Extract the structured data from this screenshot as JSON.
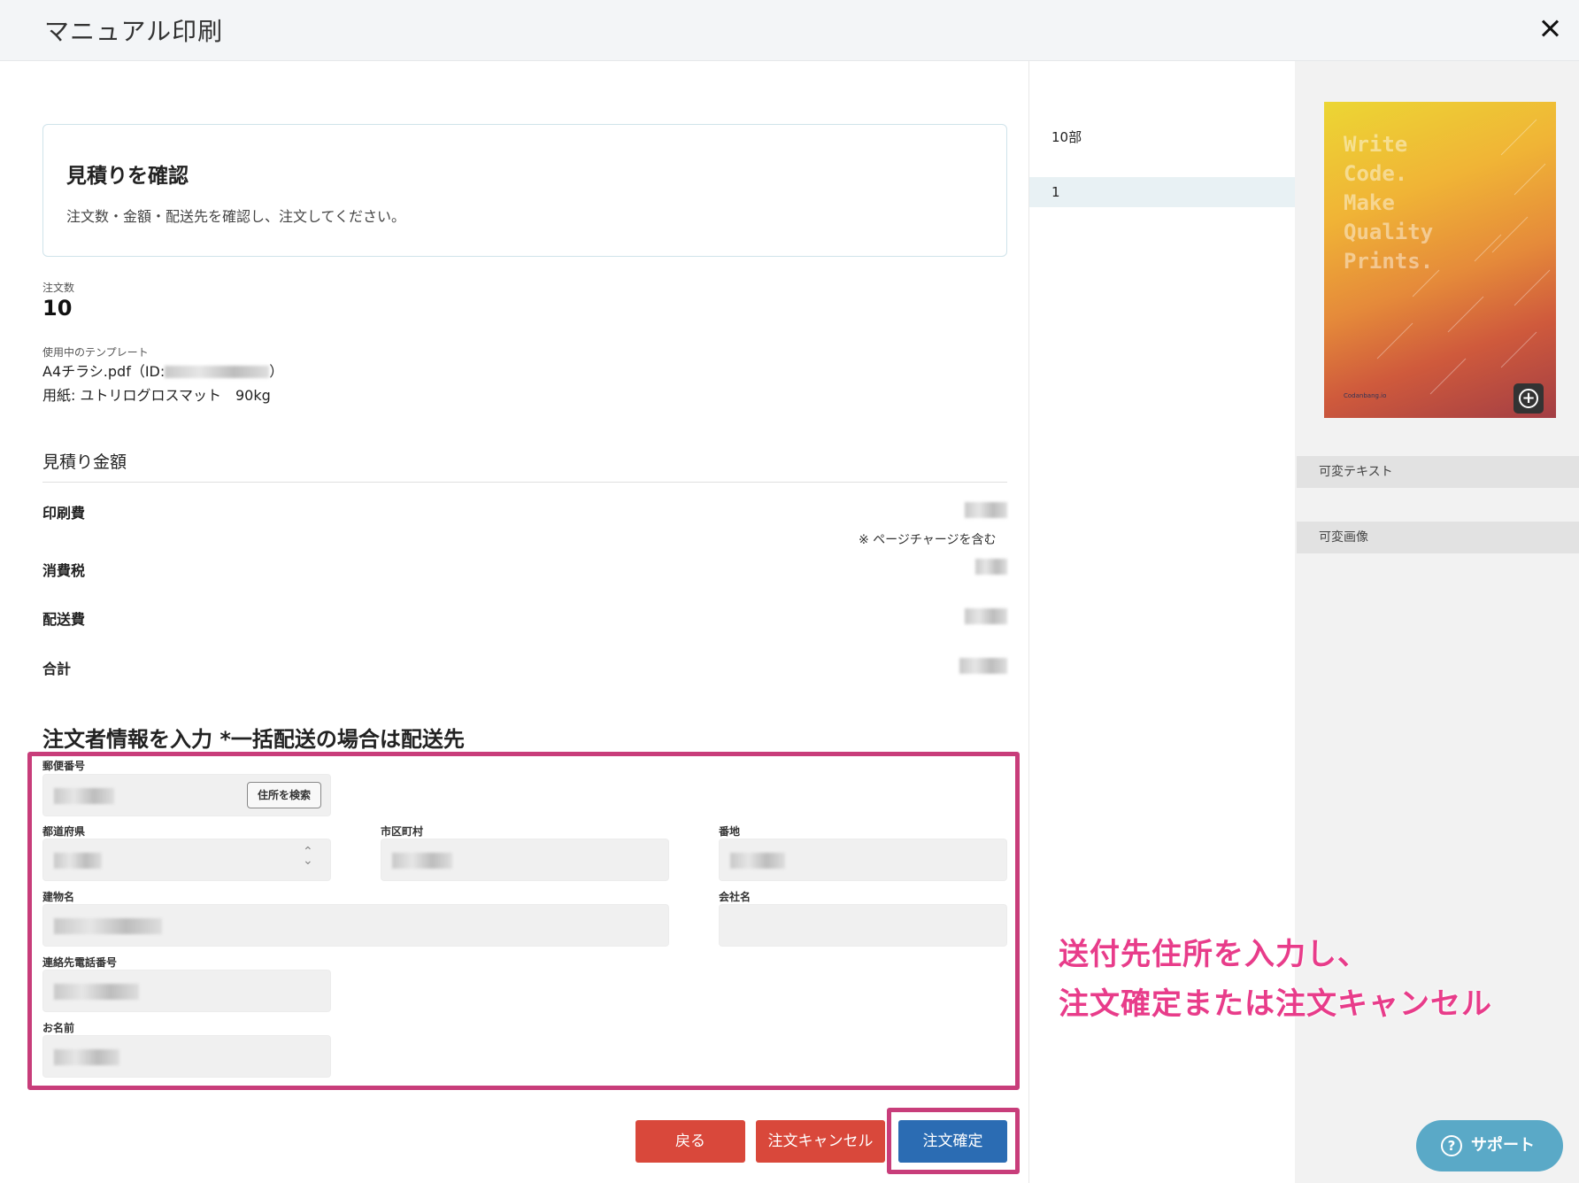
{
  "header": {
    "title": "マニュアル印刷"
  },
  "info_card": {
    "title": "見積りを確認",
    "description": "注文数・金額・配送先を確認し、注文してください。"
  },
  "order": {
    "quantity_label": "注文数",
    "quantity": "10",
    "template_label": "使用中のテンプレート",
    "template_name_prefix": "A4チラシ.pdf（ID:",
    "template_name_suffix": "）",
    "paper": "用紙: ユトリログロスマット　90kg"
  },
  "estimate": {
    "title": "見積り金額",
    "printing_label": "印刷費",
    "page_charge_note": "※ ページチャージを含む",
    "tax_label": "消費税",
    "shipping_label": "配送費",
    "total_label": "合計"
  },
  "form": {
    "heading": "注文者情報を入力 *一括配送の場合は配送先",
    "postal_label": "郵便番号",
    "search_button": "住所を検索",
    "prefecture_label": "都道府県",
    "city_label": "市区町村",
    "street_label": "番地",
    "building_label": "建物名",
    "company_label": "会社名",
    "phone_label": "連絡先電話番号",
    "name_label": "お名前"
  },
  "buttons": {
    "back": "戻る",
    "cancel": "注文キャンセル",
    "confirm": "注文確定"
  },
  "middle": {
    "copies": "10部",
    "page": "1"
  },
  "preview": {
    "text": "Write\nCode.\nMake\nQuality\nPrints.",
    "brand": "Codanbang.io",
    "zoom_icon": "plus-circle-icon"
  },
  "panel": {
    "variable_text": "可変テキスト",
    "variable_image": "可変画像"
  },
  "annotation": {
    "line1": "送付先住所を入力し、",
    "line2": "注文確定または注文キャンセル"
  },
  "support": {
    "label": "サポート",
    "icon": "help-circle-icon"
  },
  "colors": {
    "highlight": "#c83d7a",
    "red_button": "#d9483b",
    "blue_button": "#2b6cb3",
    "annotation": "#e83c8a",
    "support": "#5aa9c7"
  }
}
